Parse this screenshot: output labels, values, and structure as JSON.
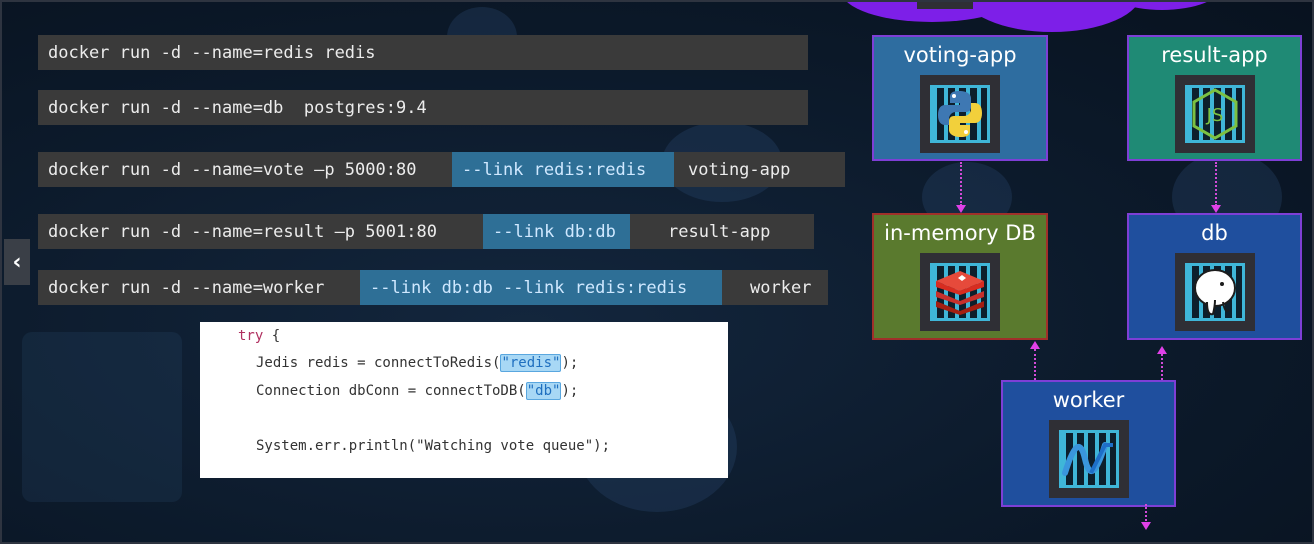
{
  "commands": [
    {
      "base": "docker run -d --name=redis redis",
      "link": "",
      "tail": ""
    },
    {
      "base": "docker run -d --name=db  postgres:9.4",
      "link": "",
      "tail": ""
    },
    {
      "base": "docker run -d --name=vote –p 5000:80",
      "link": "--link redis:redis",
      "tail": "voting-app"
    },
    {
      "base": "docker run -d --name=result –p 5001:80",
      "link": "--link db:db",
      "tail": "result-app"
    },
    {
      "base": "docker run -d --name=worker",
      "link": "--link db:db --link redis:redis",
      "tail": "worker"
    }
  ],
  "nav": {
    "back_icon": "‹"
  },
  "code": {
    "try_kw": "try",
    "try_brace": " {",
    "line2_pre": "Jedis redis = connectToRedis(",
    "line2_hl": "\"redis\"",
    "line2_post": ");",
    "line3_pre": "Connection dbConn = connectToDB(",
    "line3_hl": "\"db\"",
    "line3_post": ");",
    "line4": "System.err.println(\"Watching vote queue\");"
  },
  "services": {
    "voting_app": {
      "title": "voting-app",
      "icon": "python-icon",
      "color": "#2e6da0"
    },
    "result_app": {
      "title": "result-app",
      "icon": "nodejs-icon",
      "color": "#1f8a75"
    },
    "in_memory_db": {
      "title": "in-memory DB",
      "icon": "redis-icon",
      "color": "#5a7a2e"
    },
    "db": {
      "title": "db",
      "icon": "postgres-icon",
      "color": "#1f4f9e"
    },
    "worker": {
      "title": "worker",
      "icon": "dotnet-icon",
      "color": "#1f4f9e"
    }
  },
  "colors": {
    "cloud": "#7d1fe8",
    "connector": "#e040e8",
    "link_highlight": "#2e6f96",
    "command_bg": "#3a3a3a"
  }
}
